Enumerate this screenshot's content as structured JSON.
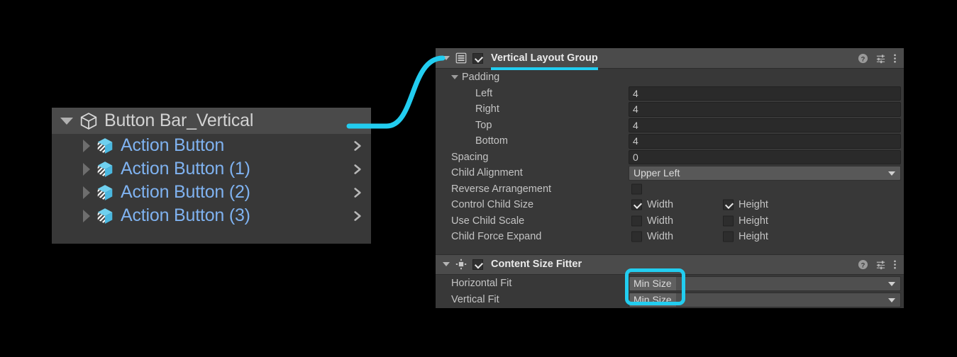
{
  "theme": {
    "background": "#000000",
    "panel_bg": "#383838",
    "header_bg": "#4b4b4b",
    "accent_cyan": "#22cdf0",
    "prefab_blue": "#7fb2f0",
    "label_gray": "#c4c4c4",
    "field_bg": "#2a2a2a",
    "dropdown_bg": "#585858"
  },
  "hierarchy": {
    "root": {
      "label": "Button Bar_Vertical",
      "icon": "gameobject-cube-icon",
      "expanded": true,
      "selected": true
    },
    "children": [
      {
        "label": "Action Button",
        "icon": "prefab-cube-icon",
        "expanded": false,
        "chevron": "chevron-right-icon"
      },
      {
        "label": "Action Button (1)",
        "icon": "prefab-cube-icon",
        "expanded": false,
        "chevron": "chevron-right-icon"
      },
      {
        "label": "Action Button (2)",
        "icon": "prefab-cube-icon",
        "expanded": false,
        "chevron": "chevron-right-icon"
      },
      {
        "label": "Action Button (3)",
        "icon": "prefab-cube-icon",
        "expanded": false,
        "chevron": "chevron-right-icon"
      }
    ]
  },
  "inspector": {
    "components": [
      {
        "title": "Vertical Layout Group",
        "icon": "layout-group-icon",
        "enabled": true,
        "expanded": true,
        "title_underlined": true,
        "header_icons": [
          "help-icon",
          "preset-icon",
          "more-menu-icon"
        ],
        "groups": [
          {
            "label": "Padding",
            "expanded": true,
            "rows": [
              {
                "label": "Left",
                "type": "number",
                "value": "4"
              },
              {
                "label": "Right",
                "type": "number",
                "value": "4"
              },
              {
                "label": "Top",
                "type": "number",
                "value": "4"
              },
              {
                "label": "Bottom",
                "type": "number",
                "value": "4"
              }
            ]
          }
        ],
        "rows": [
          {
            "label": "Spacing",
            "type": "number",
            "value": "0"
          },
          {
            "label": "Child Alignment",
            "type": "dropdown",
            "value": "Upper Left"
          },
          {
            "label": "Reverse Arrangement",
            "type": "checkbox",
            "checked": false
          },
          {
            "label": "Control Child Size",
            "type": "checkbox-pair",
            "width_label": "Width",
            "width_checked": true,
            "height_label": "Height",
            "height_checked": true
          },
          {
            "label": "Use Child Scale",
            "type": "checkbox-pair",
            "width_label": "Width",
            "width_checked": false,
            "height_label": "Height",
            "height_checked": false
          },
          {
            "label": "Child Force Expand",
            "type": "checkbox-pair",
            "width_label": "Width",
            "width_checked": false,
            "height_label": "Height",
            "height_checked": false
          }
        ]
      },
      {
        "title": "Content Size Fitter",
        "icon": "content-size-fitter-icon",
        "enabled": true,
        "expanded": true,
        "title_underlined": false,
        "header_icons": [
          "help-icon",
          "preset-icon",
          "more-menu-icon"
        ],
        "groups": [],
        "rows": [
          {
            "label": "Horizontal Fit",
            "type": "dropdown-fitter",
            "value": "Min Size"
          },
          {
            "label": "Vertical Fit",
            "type": "dropdown-fitter",
            "value": "Min Size"
          }
        ]
      }
    ]
  },
  "annotations": {
    "connector": {
      "type": "curved-line",
      "color": "#22cdf0",
      "from": "hierarchy-root-row",
      "to": "vertical-layout-group-header"
    },
    "highlight_box": {
      "type": "rounded-rect",
      "color": "#22cdf0",
      "targets": [
        "horizontal-fit-value",
        "vertical-fit-value"
      ]
    },
    "title_underline": {
      "color": "#22cdf0",
      "target": "vertical-layout-group-title"
    }
  }
}
